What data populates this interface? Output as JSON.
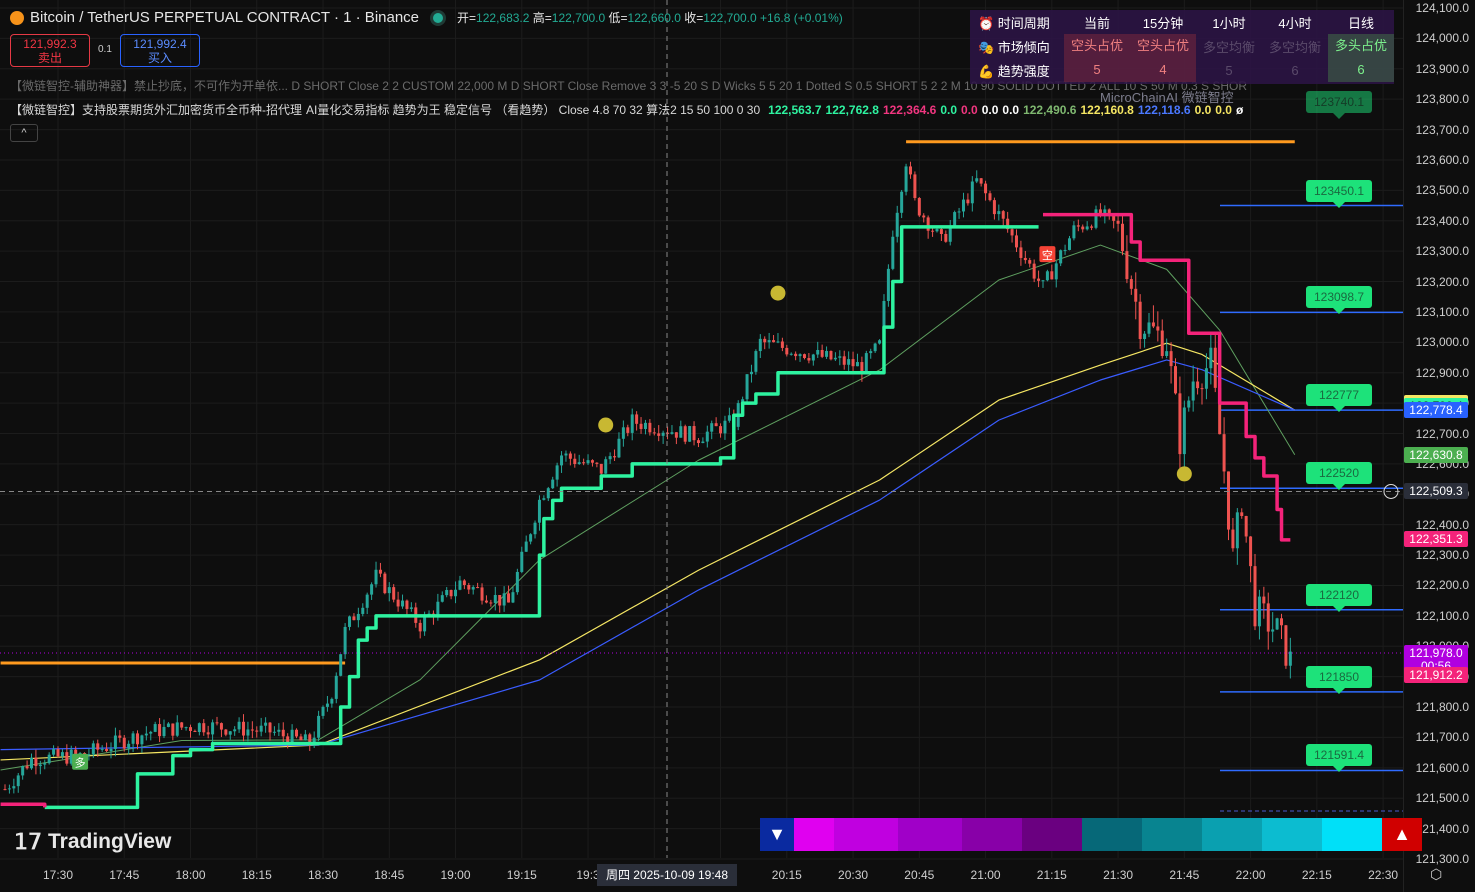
{
  "header": {
    "symbol": "Bitcoin / TetherUS PERPETUAL CONTRACT · 1 · Binance",
    "open_label": "开=",
    "open": "122,683.2",
    "high_label": "高=",
    "high": "122,700.0",
    "low_label": "低=",
    "low": "122,660.0",
    "close_label": "收=",
    "close": "122,700.0",
    "change": "+16.8 (+0.01%)"
  },
  "trade": {
    "sell_price": "121,992.3",
    "sell_label": "卖出",
    "qty": "0.1",
    "buy_price": "121,992.4",
    "buy_label": "买入"
  },
  "indicators": {
    "line1": "【微链智控-辅助神器】禁止抄底，不可作为开单依... D SHORT Close 2 2 CUSTOM 22,000 M D SHORT Close Remove 3 3 -5 20 S D Wicks 5 5 20 1 Dotted S 0.5 SHORT 5 2 2 M 10 90 SOLID DOTTED 2 ALL 10 S 50 M 0.3 S SHOR",
    "line2_name": "【微链智控】支持股票期货外汇加密货币全币种-招代理",
    "line2_desc": "AI量化交易指标 趋势为王 稳定信号 （看趋势） Close 4.8 70 32 算法2 15 50 100 0 30",
    "values": [
      {
        "v": "122,563.7",
        "c": "#2ef3a0"
      },
      {
        "v": "122,762.8",
        "c": "#2ef3a0"
      },
      {
        "v": "122,364.6",
        "c": "#f23680"
      },
      {
        "v": "0.0",
        "c": "#2ef3a0"
      },
      {
        "v": "0.0",
        "c": "#f23680"
      },
      {
        "v": "0.0",
        "c": "#ffffff"
      },
      {
        "v": "0.0",
        "c": "#ffffff"
      },
      {
        "v": "122,490.6",
        "c": "#7fb870"
      },
      {
        "v": "122,160.8",
        "c": "#f5e663"
      },
      {
        "v": "122,118.6",
        "c": "#4a78ff"
      },
      {
        "v": "0.0",
        "c": "#f5e663"
      },
      {
        "v": "0.0",
        "c": "#f5e663"
      },
      {
        "v": "ø",
        "c": "#ffffff"
      }
    ],
    "collapse": "^"
  },
  "table": {
    "headers": [
      "时间周期",
      "当前",
      "15分钟",
      "1小时",
      "4小时",
      "日线"
    ],
    "bias_label": "市场倾向",
    "bias": [
      {
        "t": "空头占优",
        "k": "bear"
      },
      {
        "t": "空头占优",
        "k": "bear"
      },
      {
        "t": "多空均衡",
        "k": "neu"
      },
      {
        "t": "多空均衡",
        "k": "neu"
      },
      {
        "t": "多头占优",
        "k": "bull"
      }
    ],
    "strength_label": "趋势强度",
    "strength": [
      {
        "t": "5",
        "k": "bear"
      },
      {
        "t": "4",
        "k": "bear"
      },
      {
        "t": "5",
        "k": "neu"
      },
      {
        "t": "6",
        "k": "neu"
      },
      {
        "t": "6",
        "k": "bull"
      }
    ]
  },
  "watermark": "MicroChainAI 微链智控",
  "brand": "TradingView",
  "crosshair": {
    "time": "周四 2025-10-09   19:48",
    "price": "122,509.3"
  },
  "chart_data": {
    "type": "candlestick",
    "time_origin": "17:30",
    "time_unit": "minutes",
    "price_axis": {
      "min": 121300,
      "max": 124100,
      "step": 100
    },
    "time_ticks": [
      "17:30",
      "17:45",
      "18:00",
      "18:15",
      "18:30",
      "18:45",
      "19:00",
      "19:15",
      "19:3",
      "20:15",
      "20:30",
      "20:45",
      "21:00",
      "21:15",
      "21:30",
      "21:45",
      "22:00",
      "22:15",
      "22:30"
    ],
    "price_path": [
      [
        -12,
        121530
      ],
      [
        -6,
        121630
      ],
      [
        5,
        121640
      ],
      [
        21,
        121720
      ],
      [
        32,
        121740
      ],
      [
        48,
        121720
      ],
      [
        57,
        121680
      ],
      [
        62,
        121850
      ],
      [
        65,
        122050
      ],
      [
        72,
        122230
      ],
      [
        82,
        122070
      ],
      [
        91,
        122210
      ],
      [
        102,
        122140
      ],
      [
        109,
        122480
      ],
      [
        114,
        122630
      ],
      [
        123,
        122580
      ],
      [
        130,
        122740
      ],
      [
        145,
        122690
      ],
      [
        153,
        122740
      ],
      [
        159,
        123000
      ],
      [
        168,
        122970
      ],
      [
        182,
        122920
      ],
      [
        186,
        122990
      ],
      [
        189,
        123370
      ],
      [
        192,
        123600
      ],
      [
        194,
        123460
      ],
      [
        200,
        123330
      ],
      [
        208,
        123530
      ],
      [
        213,
        123420
      ],
      [
        218,
        123300
      ],
      [
        223,
        123180
      ],
      [
        230,
        123370
      ],
      [
        236,
        123420
      ],
      [
        240,
        123380
      ],
      [
        245,
        123070
      ],
      [
        251,
        123000
      ],
      [
        254,
        122680
      ],
      [
        257,
        122880
      ],
      [
        261,
        122930
      ],
      [
        264,
        122580
      ],
      [
        266,
        122290
      ],
      [
        268,
        122480
      ],
      [
        271,
        122120
      ],
      [
        276,
        122050
      ],
      [
        279,
        121950
      ]
    ],
    "supertrend_up": [
      [
        -3,
        121470
      ],
      [
        12,
        121470
      ],
      [
        18,
        121580
      ],
      [
        26,
        121640
      ],
      [
        30,
        121660
      ],
      [
        35,
        121680
      ],
      [
        62,
        121680
      ],
      [
        64,
        121800
      ],
      [
        66,
        121900
      ],
      [
        68,
        122020
      ],
      [
        70,
        122060
      ],
      [
        72,
        122100
      ],
      [
        108,
        122100
      ],
      [
        109,
        122300
      ],
      [
        110,
        122420
      ],
      [
        112,
        122480
      ],
      [
        114,
        122520
      ],
      [
        120,
        122520
      ],
      [
        123,
        122560
      ],
      [
        130,
        122600
      ],
      [
        150,
        122620
      ],
      [
        153,
        122760
      ],
      [
        155,
        122800
      ],
      [
        158,
        122830
      ],
      [
        163,
        122900
      ],
      [
        186,
        122900
      ],
      [
        187,
        123050
      ],
      [
        189,
        123200
      ],
      [
        191,
        123380
      ],
      [
        222,
        123380
      ]
    ],
    "supertrend_down": [
      [
        -13,
        121480
      ],
      [
        -3,
        121470
      ],
      [
        223,
        123420
      ],
      [
        241,
        123420
      ],
      [
        243,
        123330
      ],
      [
        245,
        123270
      ],
      [
        253,
        123270
      ],
      [
        256,
        123030
      ],
      [
        262,
        123030
      ],
      [
        263,
        122800
      ],
      [
        267,
        122800
      ],
      [
        269,
        122690
      ],
      [
        271,
        122620
      ],
      [
        273,
        122560
      ],
      [
        276,
        122450
      ],
      [
        277,
        122350
      ],
      [
        279,
        122350
      ]
    ],
    "ma_yellow": [
      [
        -13,
        121626
      ],
      [
        59,
        121675
      ],
      [
        109,
        121955
      ],
      [
        145,
        122250
      ],
      [
        186,
        122547
      ],
      [
        213,
        122810
      ],
      [
        236,
        122925
      ],
      [
        251,
        122997
      ],
      [
        259,
        122960
      ],
      [
        280,
        122777
      ]
    ],
    "ma_blue": [
      [
        -13,
        121660
      ],
      [
        59,
        121675
      ],
      [
        109,
        121889
      ],
      [
        145,
        122185
      ],
      [
        186,
        122481
      ],
      [
        213,
        122744
      ],
      [
        236,
        122876
      ],
      [
        251,
        122942
      ],
      [
        259,
        122910
      ],
      [
        280,
        122777
      ]
    ],
    "ma_green": [
      [
        -13,
        121593
      ],
      [
        28,
        121690
      ],
      [
        59,
        121692
      ],
      [
        82,
        121890
      ],
      [
        109,
        122284
      ],
      [
        145,
        122612
      ],
      [
        186,
        122909
      ],
      [
        213,
        123205
      ],
      [
        236,
        123320
      ],
      [
        251,
        123240
      ],
      [
        263,
        123040
      ],
      [
        280,
        122630
      ]
    ],
    "resistance_lines": [
      {
        "price": 123660,
        "from": 192,
        "to": 280,
        "label": ""
      },
      {
        "price": 121945,
        "from": -13,
        "to": 65,
        "label": ""
      }
    ],
    "levels": [
      {
        "price": 123450,
        "label": "123450.1"
      },
      {
        "price": 123098.7,
        "label": "123098.7"
      },
      {
        "price": 122777,
        "label": "122777"
      },
      {
        "price": 122520,
        "label": "122520"
      },
      {
        "price": 122120,
        "label": "122120"
      },
      {
        "price": 121850,
        "label": "121850"
      },
      {
        "price": 121591.4,
        "label": "121591.4"
      },
      {
        "price": 123740,
        "label": "123740.1"
      }
    ],
    "signal_dots": [
      [
        124,
        122728
      ],
      [
        163,
        123162
      ],
      [
        255,
        122567
      ]
    ],
    "markers": [
      {
        "t": 5,
        "price": 121620,
        "label": "多",
        "color": "#4caf50"
      },
      {
        "t": 224,
        "price": 123290,
        "label": "空",
        "color": "#f44336"
      }
    ],
    "axis_tags": [
      {
        "v": "122,801.9",
        "bg": "#f5e663",
        "fg": "#111",
        "price": 122801.9
      },
      {
        "v": "122,790.4",
        "bg": "#2ef3a0",
        "fg": "#111",
        "price": 122790.4
      },
      {
        "v": "122,778.4",
        "bg": "#2962ff",
        "fg": "#fff",
        "price": 122778.4
      },
      {
        "v": "122,630.8",
        "bg": "#4caf50",
        "fg": "#fff",
        "price": 122630.8
      },
      {
        "v": "122,351.3",
        "bg": "#f4237a",
        "fg": "#fff",
        "price": 122351.3
      },
      {
        "v": "121,978.0",
        "bg": "#b000e0",
        "fg": "#fff",
        "price": 121978
      },
      {
        "v": "00:56",
        "bg": "#b000e0",
        "fg": "#fff",
        "price": 121935
      },
      {
        "v": "121,912.2",
        "bg": "#f4237a",
        "fg": "#fff",
        "price": 121906
      }
    ]
  },
  "strip_colors": [
    "#0a2aa0",
    "#e000f0",
    "#c000e0",
    "#a000c8",
    "#8800a8",
    "#6a0080",
    "#066878",
    "#088490",
    "#0aa0b0",
    "#0cbcd0",
    "#00e0f8",
    "#d00000"
  ],
  "colors": {
    "bg": "#0e0e0e",
    "up": "#26a69a",
    "down": "#ef5350",
    "st_up": "#2ef3a0",
    "st_down": "#f4237a"
  }
}
